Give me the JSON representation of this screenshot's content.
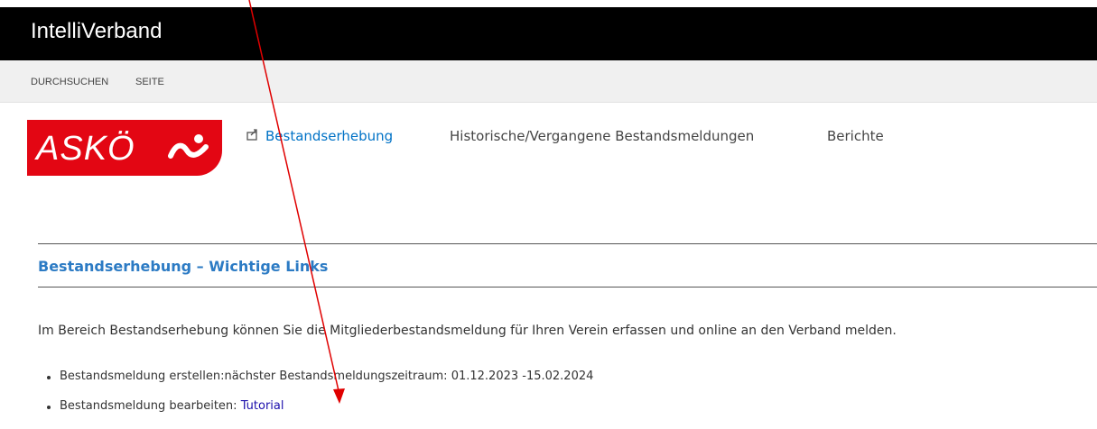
{
  "app": {
    "title": "IntelliVerband"
  },
  "ribbon": {
    "tabs": [
      "DURCHSUCHEN",
      "SEITE"
    ]
  },
  "logo": {
    "text": "ASKÖ"
  },
  "nav": {
    "items": [
      {
        "label": "Bestandserhebung",
        "active": true
      },
      {
        "label": "Historische/Vergangene Bestandsmeldungen",
        "active": false
      },
      {
        "label": "Berichte",
        "active": false
      }
    ]
  },
  "section": {
    "title": "Bestandserhebung – Wichtige Links"
  },
  "content": {
    "intro": "Im Bereich Bestandserhebung können Sie die Mitgliederbestandsmeldung für Ihren Verein erfassen und online an den Verband melden.",
    "bullets": [
      {
        "text": "Bestandsmeldung erstellen:nächster Bestandsmeldungszeitraum: 01.12.2023 -15.02.2024"
      },
      {
        "text": "Bestandsmeldung bearbeiten: ",
        "link": "Tutorial"
      }
    ]
  },
  "colors": {
    "topbar": "#000000",
    "brand_red": "#e30613",
    "accent_blue": "#0072c6",
    "annotation_red": "#e00000"
  },
  "icons": {
    "nav_active": "share-icon",
    "logo_mark": "asko-swoosh-icon"
  }
}
